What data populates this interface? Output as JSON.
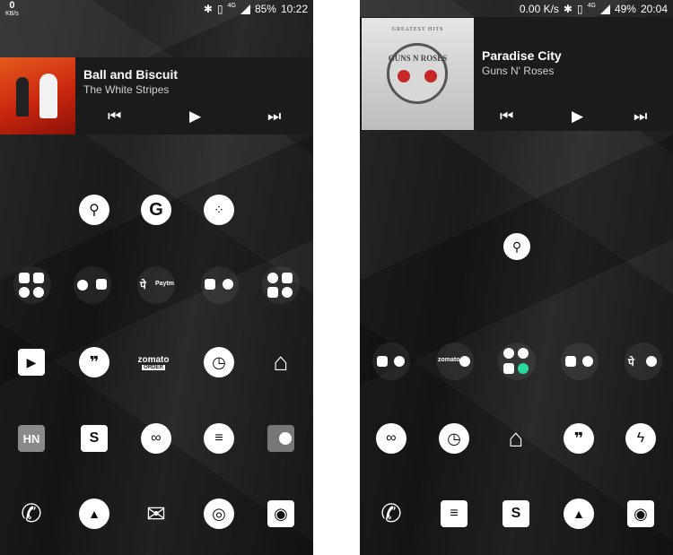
{
  "left": {
    "status": {
      "speed": "0",
      "speed_unit": "KB/s",
      "network": "4G",
      "battery": "85%",
      "time": "10:22"
    },
    "media": {
      "title": "Ball and Biscuit",
      "artist": "The White Stripes"
    },
    "icons": {
      "row1": [
        "search-icon",
        "google-icon",
        "apps-search-icon"
      ],
      "row2": [
        "folder-icon",
        "folder-icon",
        "phonepe-paytm-folder-icon",
        "folder-icon",
        "social-folder-icon"
      ],
      "row3": [
        "play-store-icon",
        "hangouts-icon",
        "zomato-icon",
        "clock-icon",
        "home-icon"
      ],
      "row4": [
        "hn-icon",
        "onenote-icon",
        "authenticator-icon",
        "messages-icon",
        "toggle-icon"
      ],
      "row5": [
        "phone-icon",
        "gallery-icon",
        "inbox-icon",
        "chrome-icon",
        "camera-icon"
      ]
    },
    "labels": {
      "paytm": "Paytm",
      "zomato": "zomato",
      "zomato_sub": "ORDER",
      "hn": "HN",
      "pe": "पे"
    }
  },
  "right": {
    "status": {
      "speed": "0.00 K/s",
      "network": "4G",
      "battery": "49%",
      "time": "20:04"
    },
    "media": {
      "title": "Paradise City",
      "artist": "Guns N' Roses",
      "album_top": "GREATEST HITS",
      "album_bottom": "GUNS N ROSES"
    },
    "labels": {
      "zomato": "zomato",
      "pe": "पे"
    }
  },
  "colors": {
    "background": "#1f1f1f",
    "panel": "#1b1b1b",
    "icon": "#ffffff"
  }
}
